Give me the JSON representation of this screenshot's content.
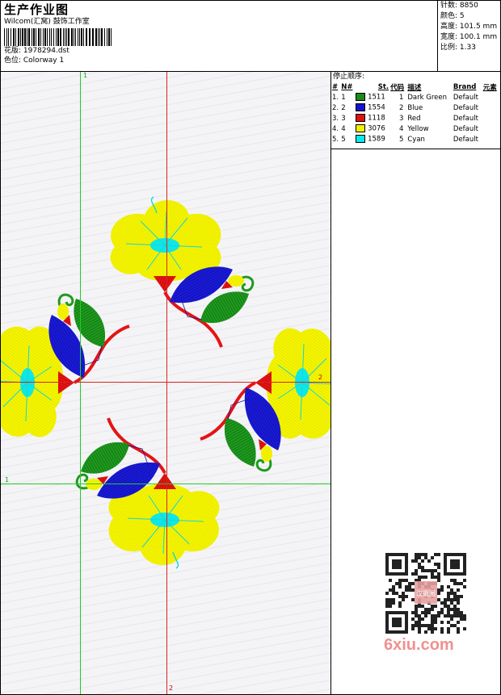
{
  "header": {
    "title": "生产作业图",
    "company": "Wilcom(汇窝) 鼓饰工作室",
    "design": "花版: 1978294.dst",
    "colorway": "色位: Colorway 1"
  },
  "stats": [
    {
      "label": "针数:",
      "value": "8850"
    },
    {
      "label": "颜色:",
      "value": "5"
    },
    {
      "label": "高度:",
      "value": "101.5 mm"
    },
    {
      "label": "宽度:",
      "value": "100.1 mm"
    },
    {
      "label": "比例:",
      "value": "1.33"
    }
  ],
  "stop_sequence_title": "停止顺序:",
  "table": {
    "headers": [
      "#",
      "N#",
      "St.",
      "代码",
      "描述",
      "Brand",
      "元素"
    ],
    "rows": [
      {
        "n": "1.",
        "seq": "1",
        "color": "#1a8a1a",
        "code": "1511",
        "num": "1",
        "desc": "Dark Green",
        "brand": "Default"
      },
      {
        "n": "2.",
        "seq": "2",
        "color": "#1414d0",
        "code": "1554",
        "num": "2",
        "desc": "Blue",
        "brand": "Default"
      },
      {
        "n": "3.",
        "seq": "3",
        "color": "#e01010",
        "code": "1118",
        "num": "3",
        "desc": "Red",
        "brand": "Default"
      },
      {
        "n": "4.",
        "seq": "4",
        "color": "#f2f200",
        "code": "3076",
        "num": "4",
        "desc": "Yellow",
        "brand": "Default"
      },
      {
        "n": "5.",
        "seq": "5",
        "color": "#10e8e8",
        "code": "1589",
        "num": "5",
        "desc": "Cyan",
        "brand": "Default"
      }
    ]
  },
  "guides": {
    "green_label": "1",
    "red_label": "2",
    "green_color": "#22cc22",
    "red_color": "#dd2222"
  },
  "watermark": "6xiu.com",
  "qr_stamp": "汉徽图"
}
